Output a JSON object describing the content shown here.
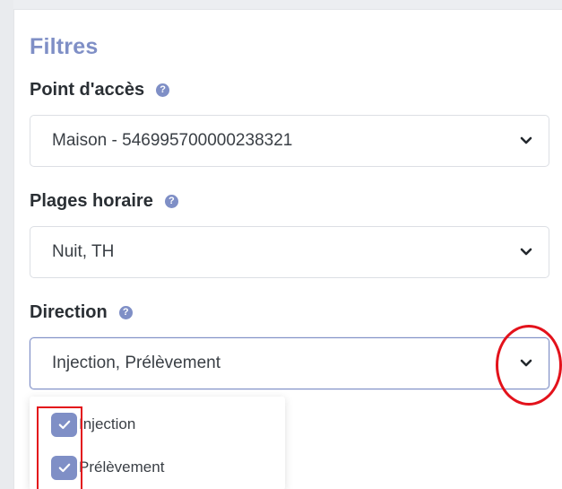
{
  "panel": {
    "title": "Filtres"
  },
  "access_point": {
    "label": "Point d'accès",
    "help_icon": "question-circle-icon",
    "value": "Maison - 546995700000238321"
  },
  "time_ranges": {
    "label": "Plages horaire",
    "help_icon": "question-circle-icon",
    "value": "Nuit, TH"
  },
  "direction": {
    "label": "Direction",
    "help_icon": "question-circle-icon",
    "value": "Injection, Prélèvement",
    "options": [
      {
        "label": "Injection",
        "checked": true
      },
      {
        "label": "Prélèvement",
        "checked": true
      }
    ]
  },
  "colors": {
    "accent": "#7f8fc6",
    "annotation": "#e3121b"
  }
}
